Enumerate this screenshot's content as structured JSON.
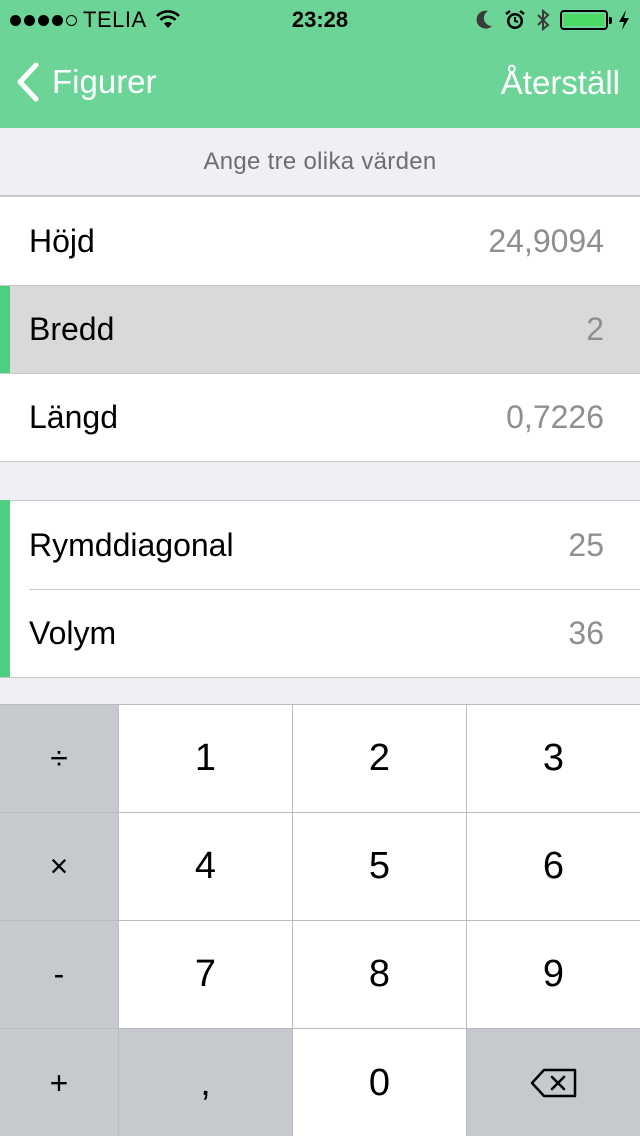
{
  "status_bar": {
    "carrier": "TELIA",
    "time": "23:28",
    "icons": [
      "signal-dots",
      "wifi-icon",
      "moon-icon",
      "alarm-icon",
      "bluetooth-icon",
      "battery-icon",
      "charging-icon"
    ]
  },
  "nav": {
    "back_label": "Figurer",
    "right_label": "Återställ"
  },
  "section_header": "Ange tre olika värden",
  "group1": [
    {
      "label": "Höjd",
      "value": "24,9094",
      "selected": false,
      "marked": false
    },
    {
      "label": "Bredd",
      "value": "2",
      "selected": true,
      "marked": true
    },
    {
      "label": "Längd",
      "value": "0,7226",
      "selected": false,
      "marked": false
    }
  ],
  "group2": [
    {
      "label": "Rymddiagonal",
      "value": "25",
      "marked": true
    },
    {
      "label": "Volym",
      "value": "36",
      "marked": true
    }
  ],
  "keypad": {
    "rows": [
      [
        "÷",
        "1",
        "2",
        "3"
      ],
      [
        "×",
        "4",
        "5",
        "6"
      ],
      [
        "-",
        "7",
        "8",
        "9"
      ],
      [
        "+",
        ",",
        "0",
        "delete-icon"
      ]
    ]
  },
  "colors": {
    "header": "#6bd496",
    "accent_marker": "#4cd080",
    "keypad_dark": "#c6c9ce",
    "selected_row": "#d9d9d9"
  }
}
